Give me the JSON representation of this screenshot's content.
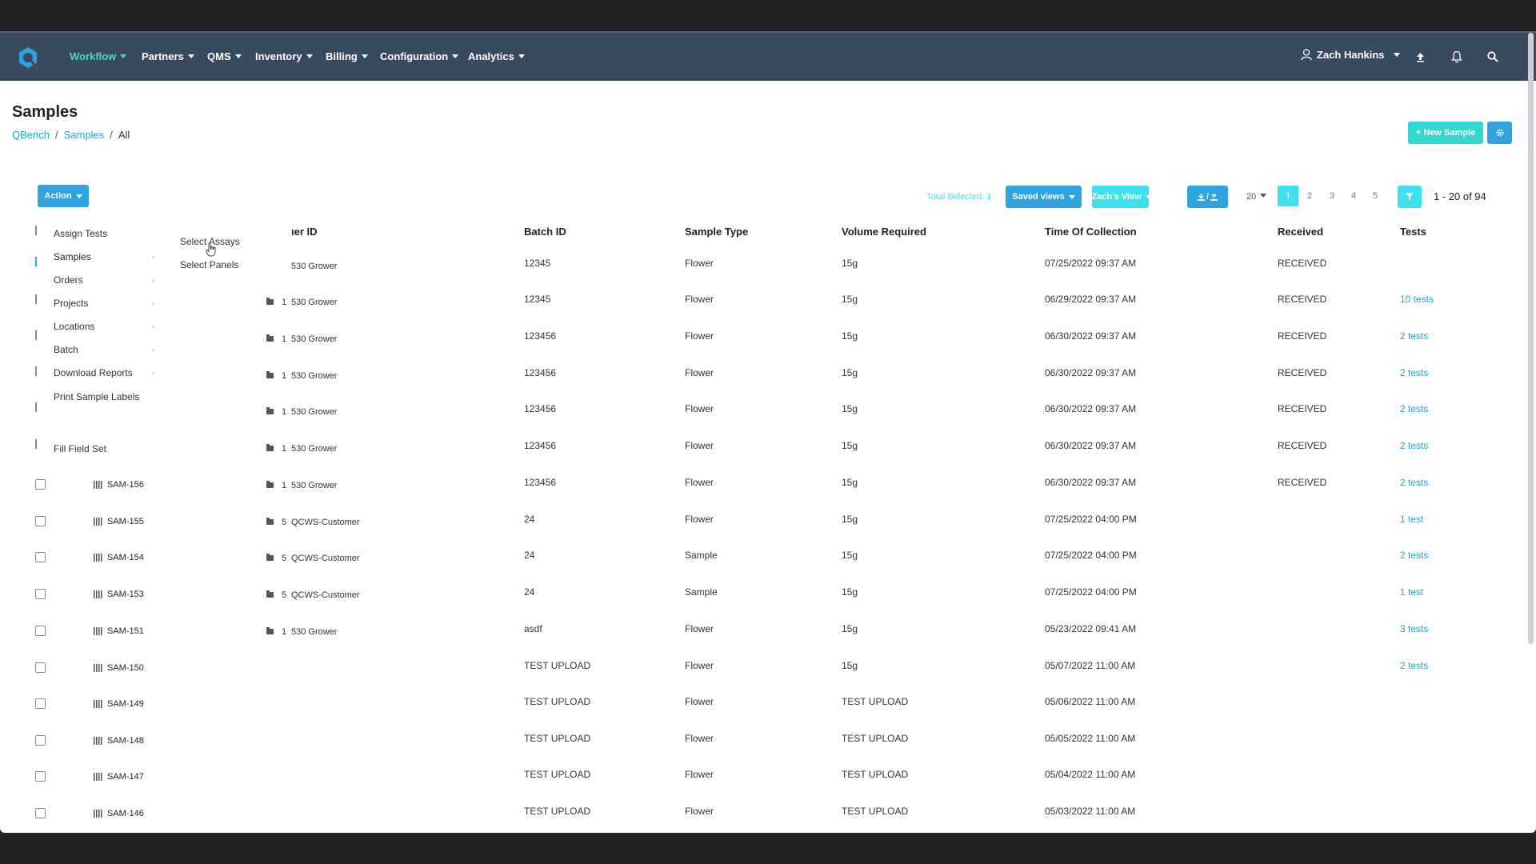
{
  "colors": {
    "nav_bg": "#3a4a5e",
    "accent_teal": "#4fd3c4",
    "link_blue": "#1aa9d8",
    "button_blue": "#2ea3e0",
    "button_cyan": "#3ee0f0"
  },
  "nav": {
    "items": [
      {
        "label": "Workflow",
        "active": true
      },
      {
        "label": "Partners"
      },
      {
        "label": "QMS"
      },
      {
        "label": "Inventory"
      },
      {
        "label": "Billing"
      },
      {
        "label": "Configuration"
      },
      {
        "label": "Analytics"
      }
    ],
    "user_name": "Zach Hankins",
    "icons": [
      "user-icon",
      "upload-icon",
      "bell-icon",
      "search-icon"
    ]
  },
  "page": {
    "title": "Samples",
    "breadcrumb": [
      "QBench",
      "Samples",
      "All"
    ]
  },
  "header_buttons": {
    "new_sample": "+ New Sample",
    "settings_icon": "gear-icon"
  },
  "toolbar": {
    "action_label": "Action",
    "total_selected_label": "Total Selected:",
    "total_selected_count": "1",
    "saved_views": "Saved views",
    "view_name": "Zach's View",
    "import_export": "/",
    "page_size": "20",
    "pages": [
      "1",
      "2",
      "3",
      "4",
      "5"
    ],
    "current_page": "1",
    "range_text": "1 - 20 of 94"
  },
  "action_menu": {
    "items": [
      {
        "label": "Assign Tests",
        "submenu": false
      },
      {
        "label": "Samples",
        "submenu": true
      },
      {
        "label": "Orders",
        "submenu": true
      },
      {
        "label": "Projects",
        "submenu": true
      },
      {
        "label": "Locations",
        "submenu": true
      },
      {
        "label": "Batch",
        "submenu": true
      },
      {
        "label": "Download Reports",
        "submenu": true
      },
      {
        "label": "Print Sample Labels",
        "submenu": false
      },
      {
        "label": "Fill Field Set",
        "submenu": false
      }
    ],
    "submenu": [
      "Select Assays",
      "Select Panels"
    ]
  },
  "table": {
    "headers": [
      "ıer ID",
      "Batch ID",
      "Sample Type",
      "Volume Required",
      "Time Of Collection",
      "Received",
      "Tests"
    ],
    "rows": [
      {
        "sample_id": "",
        "order_id": "",
        "customer": "530 Grower",
        "batch_id": "12345",
        "type": "Flower",
        "volume": "15g",
        "time": "07/25/2022 09:37 AM",
        "received": "RECEIVED",
        "tests": ""
      },
      {
        "sample_id": "",
        "order_id": "1",
        "customer": "530 Grower",
        "batch_id": "12345",
        "type": "Flower",
        "volume": "15g",
        "time": "06/29/2022 09:37 AM",
        "received": "RECEIVED",
        "tests": "10 tests"
      },
      {
        "sample_id": "",
        "order_id": "1",
        "customer": "530 Grower",
        "batch_id": "123456",
        "type": "Flower",
        "volume": "15g",
        "time": "06/30/2022 09:37 AM",
        "received": "RECEIVED",
        "tests": "2 tests"
      },
      {
        "sample_id": "",
        "order_id": "1",
        "customer": "530 Grower",
        "batch_id": "123456",
        "type": "Flower",
        "volume": "15g",
        "time": "06/30/2022 09:37 AM",
        "received": "RECEIVED",
        "tests": "2 tests"
      },
      {
        "sample_id": "",
        "order_id": "1",
        "customer": "530 Grower",
        "batch_id": "123456",
        "type": "Flower",
        "volume": "15g",
        "time": "06/30/2022 09:37 AM",
        "received": "RECEIVED",
        "tests": "2 tests"
      },
      {
        "sample_id": "",
        "order_id": "1",
        "customer": "530 Grower",
        "batch_id": "123456",
        "type": "Flower",
        "volume": "15g",
        "time": "06/30/2022 09:37 AM",
        "received": "RECEIVED",
        "tests": "2 tests"
      },
      {
        "sample_id": "SAM-156",
        "order_id": "1",
        "customer": "530 Grower",
        "batch_id": "123456",
        "type": "Flower",
        "volume": "15g",
        "time": "06/30/2022 09:37 AM",
        "received": "RECEIVED",
        "tests": "2 tests"
      },
      {
        "sample_id": "SAM-155",
        "order_id": "5",
        "customer": "QCWS-Customer",
        "batch_id": "24",
        "type": "Flower",
        "volume": "15g",
        "time": "07/25/2022 04:00 PM",
        "received": "",
        "tests": "1 test"
      },
      {
        "sample_id": "SAM-154",
        "order_id": "5",
        "customer": "QCWS-Customer",
        "batch_id": "24",
        "type": "Sample",
        "volume": "15g",
        "time": "07/25/2022 04:00 PM",
        "received": "",
        "tests": "2 tests"
      },
      {
        "sample_id": "SAM-153",
        "order_id": "5",
        "customer": "QCWS-Customer",
        "batch_id": "24",
        "type": "Sample",
        "volume": "15g",
        "time": "07/25/2022 04:00 PM",
        "received": "",
        "tests": "1 test"
      },
      {
        "sample_id": "SAM-151",
        "order_id": "1",
        "customer": "530 Grower",
        "batch_id": "asdf",
        "type": "Flower",
        "volume": "15g",
        "time": "05/23/2022 09:41 AM",
        "received": "",
        "tests": "3 tests"
      },
      {
        "sample_id": "SAM-150",
        "order_id": "",
        "customer": "",
        "batch_id": "TEST UPLOAD",
        "type": "Flower",
        "volume": "15g",
        "time": "05/07/2022 11:00 AM",
        "received": "",
        "tests": "2 tests"
      },
      {
        "sample_id": "SAM-149",
        "order_id": "",
        "customer": "",
        "batch_id": "TEST UPLOAD",
        "type": "Flower",
        "volume": "TEST UPLOAD",
        "time": "05/06/2022 11:00 AM",
        "received": "",
        "tests": ""
      },
      {
        "sample_id": "SAM-148",
        "order_id": "",
        "customer": "",
        "batch_id": "TEST UPLOAD",
        "type": "Flower",
        "volume": "TEST UPLOAD",
        "time": "05/05/2022 11:00 AM",
        "received": "",
        "tests": ""
      },
      {
        "sample_id": "SAM-147",
        "order_id": "",
        "customer": "",
        "batch_id": "TEST UPLOAD",
        "type": "Flower",
        "volume": "TEST UPLOAD",
        "time": "05/04/2022 11:00 AM",
        "received": "",
        "tests": ""
      },
      {
        "sample_id": "SAM-146",
        "order_id": "",
        "customer": "",
        "batch_id": "TEST UPLOAD",
        "type": "Flower",
        "volume": "TEST UPLOAD",
        "time": "05/03/2022 11:00 AM",
        "received": "",
        "tests": ""
      }
    ]
  }
}
